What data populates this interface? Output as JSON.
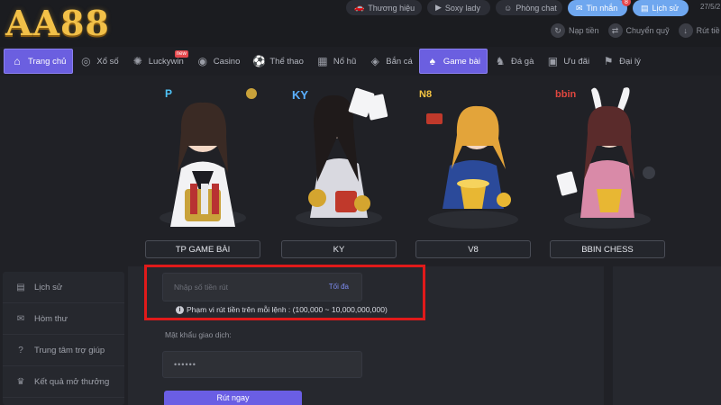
{
  "logo": {
    "text": "AA88",
    "color": "#f2c048"
  },
  "header": {
    "quick_links": [
      {
        "label": "Thương hiệu",
        "icon": "car-icon"
      },
      {
        "label": "Soxy lady",
        "icon": "play-icon"
      },
      {
        "label": "Phòng chat",
        "icon": "chat-icon"
      }
    ],
    "inbox": {
      "label": "Tin nhắn",
      "badge": "8"
    },
    "history": {
      "label": "Lịch sử"
    },
    "date": "27/5/2",
    "actions": [
      {
        "label": "Nạp tiền",
        "icon": "deposit-icon"
      },
      {
        "label": "Chuyển quỹ",
        "icon": "transfer-icon"
      },
      {
        "label": "Rút tiề",
        "icon": "withdraw-icon"
      }
    ]
  },
  "nav": {
    "items": [
      {
        "label": "Trang chủ",
        "icon": "home-icon",
        "glyph": "⌂",
        "active": true
      },
      {
        "label": "Xổ số",
        "icon": "lottery-icon",
        "glyph": "◎"
      },
      {
        "label": "Luckywin",
        "icon": "luckywin-icon",
        "glyph": "✺",
        "tag": "new"
      },
      {
        "label": "Casino",
        "icon": "casino-chip-icon",
        "glyph": "◉"
      },
      {
        "label": "Thể thao",
        "icon": "soccer-ball-icon",
        "glyph": "⚽"
      },
      {
        "label": "Nổ hũ",
        "icon": "slot-icon",
        "glyph": "▦"
      },
      {
        "label": "Bắn cá",
        "icon": "fish-icon",
        "glyph": "◈"
      },
      {
        "label": "Game bài",
        "icon": "cards-icon",
        "glyph": "♠",
        "active": true
      },
      {
        "label": "Đá gà",
        "icon": "rooster-icon",
        "glyph": "♞"
      },
      {
        "label": "Ưu đãi",
        "icon": "gift-icon",
        "glyph": "▣"
      },
      {
        "label": "Đại lý",
        "icon": "agent-icon",
        "glyph": "⚑"
      }
    ]
  },
  "games": [
    {
      "label": "TP GAME BÀI",
      "brand": "P",
      "brand_color": "#4fc3f7"
    },
    {
      "label": "KY",
      "brand": "KY",
      "brand_color": "#5ab0ff"
    },
    {
      "label": "V8",
      "brand": "N8",
      "brand_color": "#f5c542"
    },
    {
      "label": "BBIN CHESS",
      "brand": "bbin",
      "brand_color": "#e0473f"
    }
  ],
  "sidebar": {
    "items": [
      {
        "label": "Lịch sử",
        "icon": "history-icon"
      },
      {
        "label": "Hòm thư",
        "icon": "mailbox-icon"
      },
      {
        "label": "Trung tâm trợ giúp",
        "icon": "help-icon"
      },
      {
        "label": "Kết quả mở thưởng",
        "icon": "trophy-icon"
      }
    ]
  },
  "withdraw": {
    "amount_placeholder": "Nhập số tiền rút",
    "max_label": "Tối đa",
    "range_note": "Phạm vi rút tiền trên mỗi lệnh : (100,000 ~ 10,000,000,000)",
    "password_label": "Mật khẩu giao dịch:",
    "password_value": "••••••",
    "submit_label": "Rút ngay"
  },
  "colors": {
    "accent": "#6b5fe0",
    "highlight": "#e01a1a",
    "link": "#6fa7ef"
  }
}
